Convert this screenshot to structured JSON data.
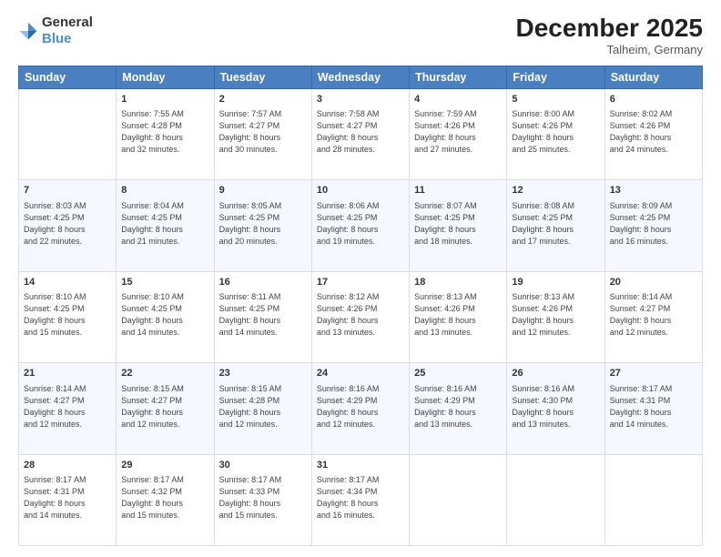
{
  "header": {
    "logo_general": "General",
    "logo_blue": "Blue",
    "month_title": "December 2025",
    "location": "Talheim, Germany"
  },
  "days_of_week": [
    "Sunday",
    "Monday",
    "Tuesday",
    "Wednesday",
    "Thursday",
    "Friday",
    "Saturday"
  ],
  "weeks": [
    [
      {
        "day": "",
        "content": ""
      },
      {
        "day": "1",
        "content": "Sunrise: 7:55 AM\nSunset: 4:28 PM\nDaylight: 8 hours\nand 32 minutes."
      },
      {
        "day": "2",
        "content": "Sunrise: 7:57 AM\nSunset: 4:27 PM\nDaylight: 8 hours\nand 30 minutes."
      },
      {
        "day": "3",
        "content": "Sunrise: 7:58 AM\nSunset: 4:27 PM\nDaylight: 8 hours\nand 28 minutes."
      },
      {
        "day": "4",
        "content": "Sunrise: 7:59 AM\nSunset: 4:26 PM\nDaylight: 8 hours\nand 27 minutes."
      },
      {
        "day": "5",
        "content": "Sunrise: 8:00 AM\nSunset: 4:26 PM\nDaylight: 8 hours\nand 25 minutes."
      },
      {
        "day": "6",
        "content": "Sunrise: 8:02 AM\nSunset: 4:26 PM\nDaylight: 8 hours\nand 24 minutes."
      }
    ],
    [
      {
        "day": "7",
        "content": "Sunrise: 8:03 AM\nSunset: 4:25 PM\nDaylight: 8 hours\nand 22 minutes."
      },
      {
        "day": "8",
        "content": "Sunrise: 8:04 AM\nSunset: 4:25 PM\nDaylight: 8 hours\nand 21 minutes."
      },
      {
        "day": "9",
        "content": "Sunrise: 8:05 AM\nSunset: 4:25 PM\nDaylight: 8 hours\nand 20 minutes."
      },
      {
        "day": "10",
        "content": "Sunrise: 8:06 AM\nSunset: 4:25 PM\nDaylight: 8 hours\nand 19 minutes."
      },
      {
        "day": "11",
        "content": "Sunrise: 8:07 AM\nSunset: 4:25 PM\nDaylight: 8 hours\nand 18 minutes."
      },
      {
        "day": "12",
        "content": "Sunrise: 8:08 AM\nSunset: 4:25 PM\nDaylight: 8 hours\nand 17 minutes."
      },
      {
        "day": "13",
        "content": "Sunrise: 8:09 AM\nSunset: 4:25 PM\nDaylight: 8 hours\nand 16 minutes."
      }
    ],
    [
      {
        "day": "14",
        "content": "Sunrise: 8:10 AM\nSunset: 4:25 PM\nDaylight: 8 hours\nand 15 minutes."
      },
      {
        "day": "15",
        "content": "Sunrise: 8:10 AM\nSunset: 4:25 PM\nDaylight: 8 hours\nand 14 minutes."
      },
      {
        "day": "16",
        "content": "Sunrise: 8:11 AM\nSunset: 4:25 PM\nDaylight: 8 hours\nand 14 minutes."
      },
      {
        "day": "17",
        "content": "Sunrise: 8:12 AM\nSunset: 4:26 PM\nDaylight: 8 hours\nand 13 minutes."
      },
      {
        "day": "18",
        "content": "Sunrise: 8:13 AM\nSunset: 4:26 PM\nDaylight: 8 hours\nand 13 minutes."
      },
      {
        "day": "19",
        "content": "Sunrise: 8:13 AM\nSunset: 4:26 PM\nDaylight: 8 hours\nand 12 minutes."
      },
      {
        "day": "20",
        "content": "Sunrise: 8:14 AM\nSunset: 4:27 PM\nDaylight: 8 hours\nand 12 minutes."
      }
    ],
    [
      {
        "day": "21",
        "content": "Sunrise: 8:14 AM\nSunset: 4:27 PM\nDaylight: 8 hours\nand 12 minutes."
      },
      {
        "day": "22",
        "content": "Sunrise: 8:15 AM\nSunset: 4:27 PM\nDaylight: 8 hours\nand 12 minutes."
      },
      {
        "day": "23",
        "content": "Sunrise: 8:15 AM\nSunset: 4:28 PM\nDaylight: 8 hours\nand 12 minutes."
      },
      {
        "day": "24",
        "content": "Sunrise: 8:16 AM\nSunset: 4:29 PM\nDaylight: 8 hours\nand 12 minutes."
      },
      {
        "day": "25",
        "content": "Sunrise: 8:16 AM\nSunset: 4:29 PM\nDaylight: 8 hours\nand 13 minutes."
      },
      {
        "day": "26",
        "content": "Sunrise: 8:16 AM\nSunset: 4:30 PM\nDaylight: 8 hours\nand 13 minutes."
      },
      {
        "day": "27",
        "content": "Sunrise: 8:17 AM\nSunset: 4:31 PM\nDaylight: 8 hours\nand 14 minutes."
      }
    ],
    [
      {
        "day": "28",
        "content": "Sunrise: 8:17 AM\nSunset: 4:31 PM\nDaylight: 8 hours\nand 14 minutes."
      },
      {
        "day": "29",
        "content": "Sunrise: 8:17 AM\nSunset: 4:32 PM\nDaylight: 8 hours\nand 15 minutes."
      },
      {
        "day": "30",
        "content": "Sunrise: 8:17 AM\nSunset: 4:33 PM\nDaylight: 8 hours\nand 15 minutes."
      },
      {
        "day": "31",
        "content": "Sunrise: 8:17 AM\nSunset: 4:34 PM\nDaylight: 8 hours\nand 16 minutes."
      },
      {
        "day": "",
        "content": ""
      },
      {
        "day": "",
        "content": ""
      },
      {
        "day": "",
        "content": ""
      }
    ]
  ]
}
